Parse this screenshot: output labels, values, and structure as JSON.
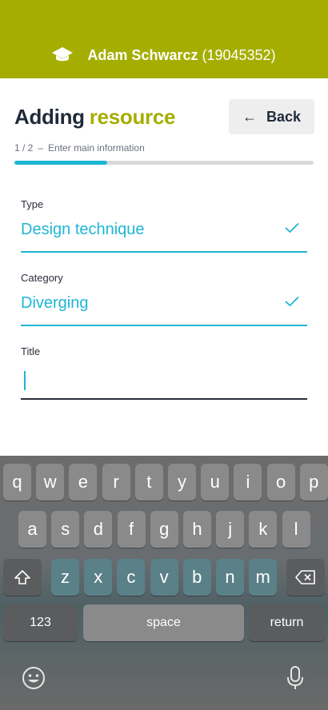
{
  "header": {
    "user_name": "Adam Schwarcz",
    "user_id": "(19045352)",
    "icon": "graduation-cap-icon"
  },
  "page": {
    "title_part1": "Adding",
    "title_part2": "resource",
    "back_label": "Back",
    "step": "1 / 2",
    "step_separator": "–",
    "step_text": "Enter main information",
    "progress": 0.31
  },
  "form": {
    "type_label": "Type",
    "type_value": "Design technique",
    "category_label": "Category",
    "category_value": "Diverging",
    "title_label": "Title",
    "title_value": ""
  },
  "keyboard": {
    "row1": [
      "q",
      "w",
      "e",
      "r",
      "t",
      "y",
      "u",
      "i",
      "o",
      "p"
    ],
    "row2": [
      "a",
      "s",
      "d",
      "f",
      "g",
      "h",
      "j",
      "k",
      "l"
    ],
    "row3": [
      "z",
      "x",
      "c",
      "v",
      "b",
      "n",
      "m"
    ],
    "numbers_label": "123",
    "space_label": "space",
    "return_label": "return"
  },
  "colors": {
    "brand_green": "#a5ae00",
    "accent_cyan": "#1eb6d4",
    "text_dark": "#1f2a3a"
  }
}
